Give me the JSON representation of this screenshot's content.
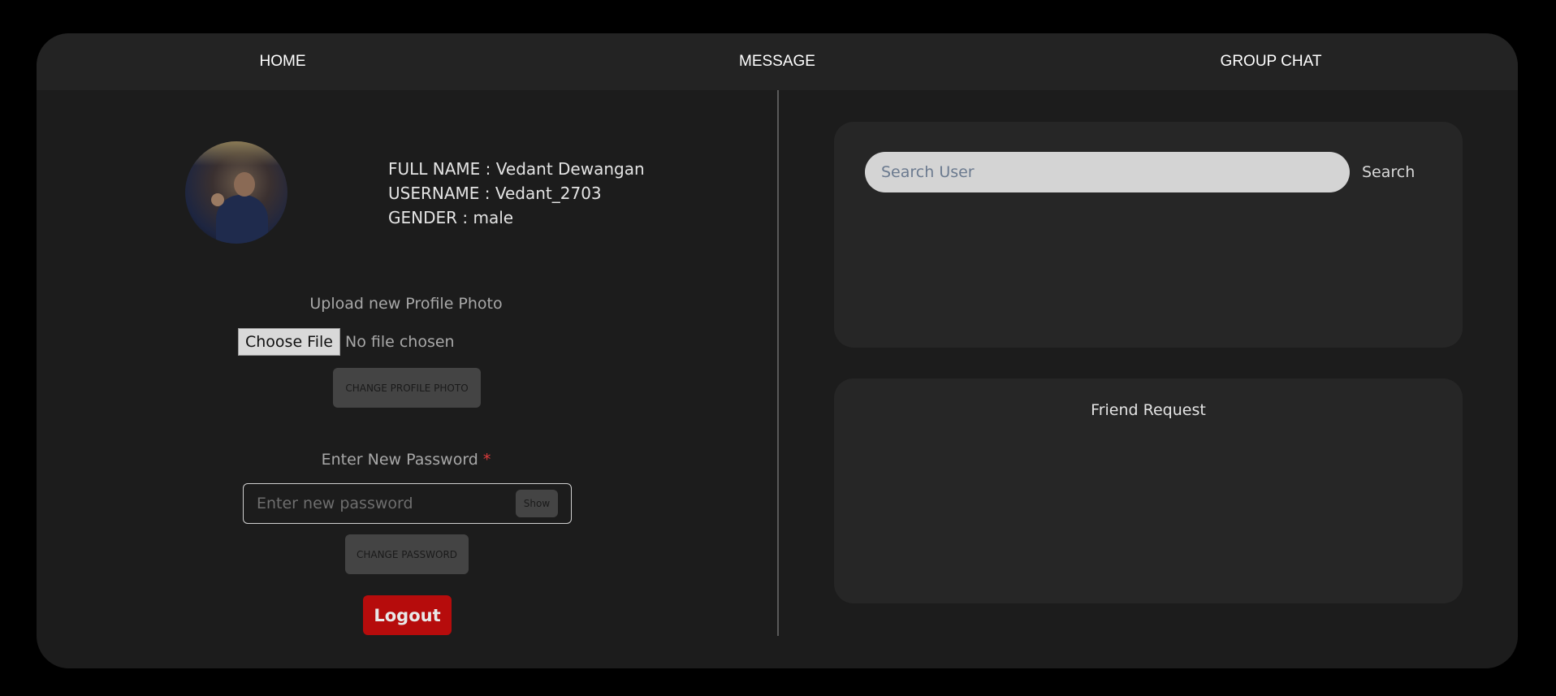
{
  "nav": {
    "home": "HOME",
    "message": "MESSAGE",
    "group_chat": "GROUP CHAT"
  },
  "profile": {
    "full_name_line": "FULL NAME : Vedant Dewangan",
    "username_line": "USERNAME : Vedant_2703",
    "gender_line": "GENDER : male"
  },
  "upload": {
    "label": "Upload new Profile Photo",
    "choose_file": "Choose File",
    "no_file": "No file chosen",
    "change_photo_button": "CHANGE PROFILE PHOTO"
  },
  "password": {
    "label": "Enter New Password",
    "required_mark": "*",
    "placeholder": "Enter new password",
    "show_button": "Show",
    "change_button": "CHANGE PASSWORD"
  },
  "logout": "Logout",
  "search": {
    "placeholder": "Search User",
    "button": "Search"
  },
  "friend_request": {
    "title": "Friend Request"
  },
  "colors": {
    "background": "#000000",
    "app": "#1c1c1c",
    "nav": "#232323",
    "card": "#262626",
    "logout": "#b60c0c",
    "required": "#dd3b3b"
  }
}
